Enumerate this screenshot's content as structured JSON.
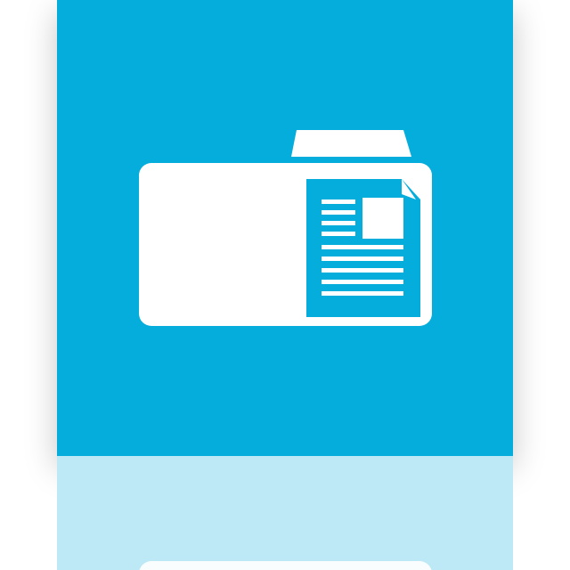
{
  "tile": {
    "background_color": "#04ADDB",
    "icon": "folder-document-icon",
    "icon_color": "#FFFFFF"
  },
  "reflection": {
    "background_color": "#BDE8F5",
    "icon": "folder-document-reflection-icon"
  }
}
